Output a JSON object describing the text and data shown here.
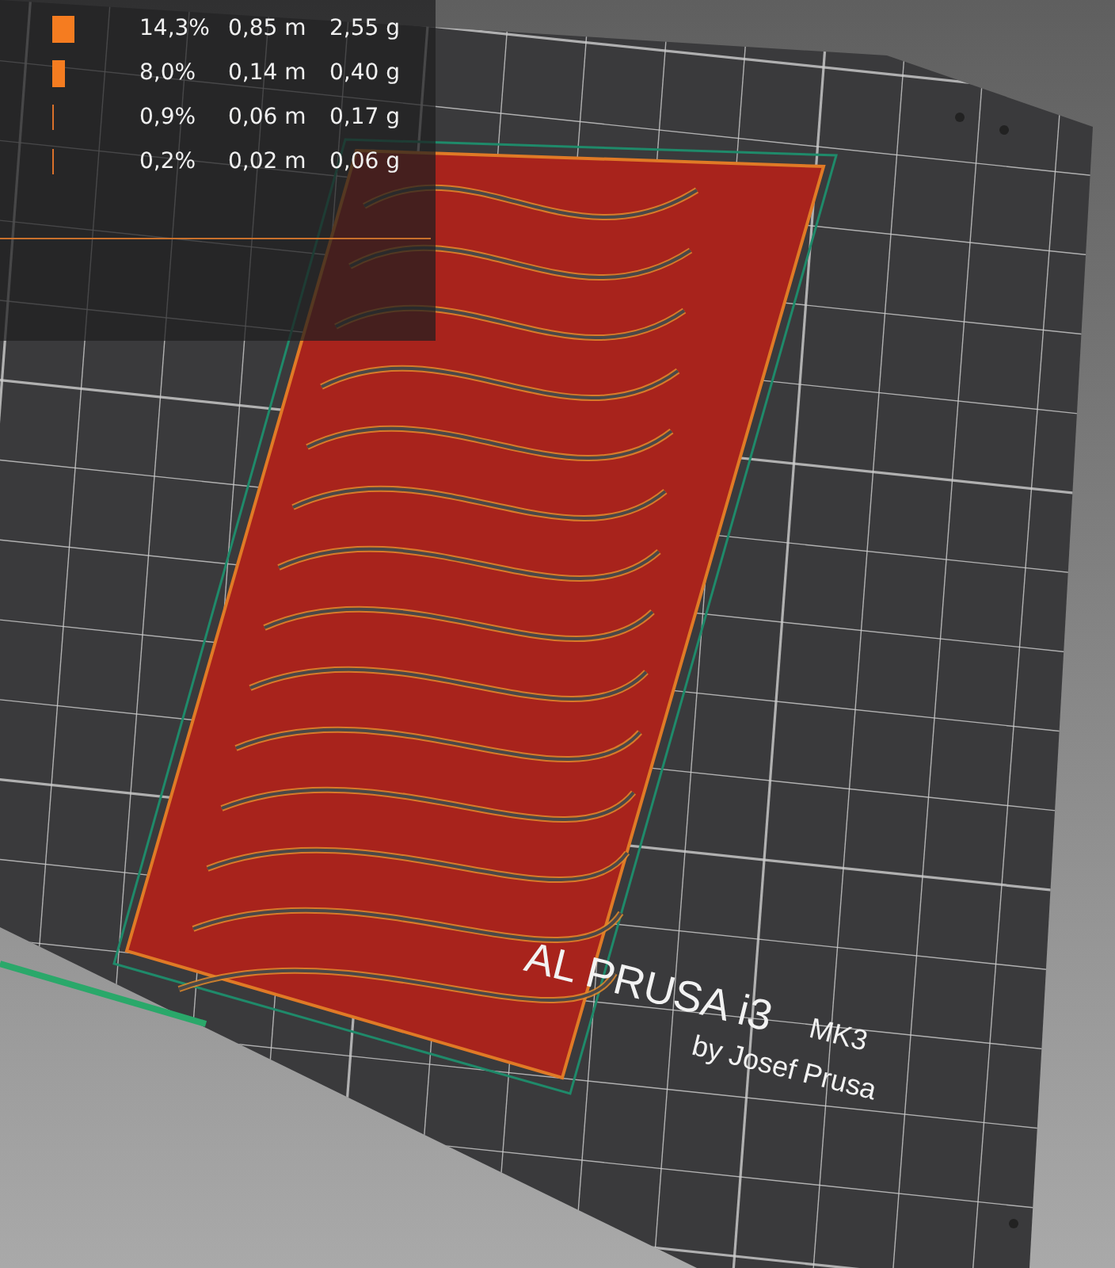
{
  "legend": {
    "rows": [
      {
        "kind": "block",
        "percent": "14,3%",
        "length": "0,85 m",
        "weight": "2,55 g"
      },
      {
        "kind": "bar",
        "percent": "8,0%",
        "length": "0,14 m",
        "weight": "0,40 g"
      },
      {
        "kind": "line",
        "percent": "0,9%",
        "length": "0,06 m",
        "weight": "0,17 g"
      },
      {
        "kind": "line",
        "percent": "0,2%",
        "length": "0,02 m",
        "weight": "0,06 g"
      }
    ]
  },
  "bed": {
    "logo": "AL PRUSA i3",
    "model": "MK3",
    "author": "by Josef Prusa"
  }
}
